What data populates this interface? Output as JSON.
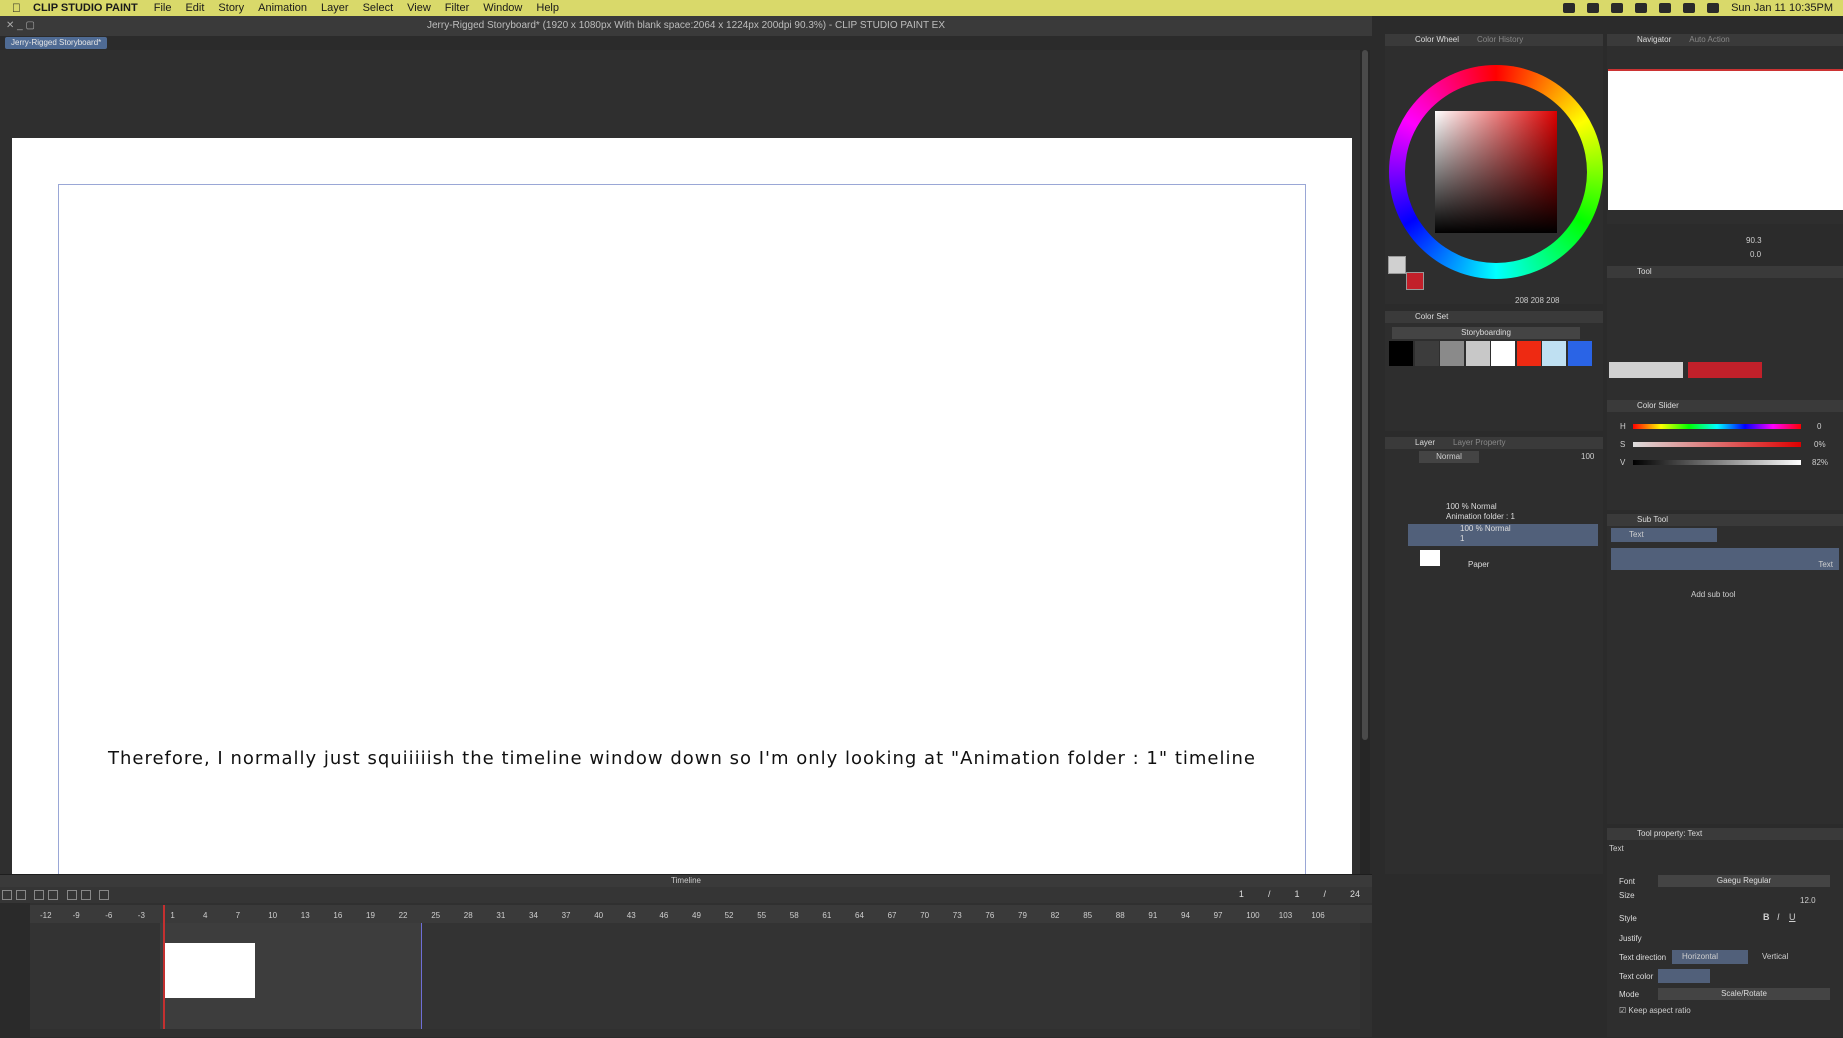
{
  "menubar": {
    "app": "CLIP STUDIO PAINT",
    "items": [
      "File",
      "Edit",
      "Story",
      "Animation",
      "Layer",
      "Select",
      "View",
      "Filter",
      "Window",
      "Help"
    ],
    "clock": "Sun Jan 11  10:35PM"
  },
  "title": "Jerry-Rigged Storyboard* (1920 x 1080px With blank space:2064 x 1224px 200dpi 90.3%)  - CLIP STUDIO PAINT EX",
  "doc_tab": "Jerry-Rigged Storyboard*",
  "canvas": {
    "caption": "Therefore, I normally just squiiiiish the timeline window down so I'm only looking at \"Animation folder : 1\" timeline"
  },
  "timeline": {
    "title": "Timeline",
    "frame_current": "1",
    "frame_sep": "/",
    "frame_total_a": "1",
    "frame_sep2": "/",
    "frame_total_b": "24",
    "ticks": [
      "-12",
      "-9",
      "-6",
      "-3",
      "1",
      "4",
      "7",
      "10",
      "13",
      "16",
      "19",
      "22",
      "25",
      "28",
      "31",
      "34",
      "37",
      "40",
      "43",
      "46",
      "49",
      "52",
      "55",
      "58",
      "61",
      "64",
      "67",
      "70",
      "73",
      "76",
      "79",
      "82",
      "85",
      "88",
      "91",
      "94",
      "97",
      "100",
      "103",
      "106"
    ]
  },
  "color_wheel": {
    "tab": "Color Wheel",
    "tab2": "Color History",
    "readout": "208  208  208",
    "main_color": "#d0d0d0",
    "sub_color": "#c2202a"
  },
  "color_set": {
    "title": "Color Set",
    "set_name": "Storyboarding",
    "chips": [
      "#000000",
      "#3c3c3c",
      "#8a8a8a",
      "#c8c8c8",
      "#ffffff",
      "#ee2a12",
      "#bfe0f2",
      "#2a64e6"
    ]
  },
  "layer": {
    "tab": "Layer",
    "tab2": "Layer Property",
    "blend": "Normal",
    "opacity": "100",
    "rows": [
      {
        "line1": "100 % Normal",
        "line2": "Animation folder : 1"
      },
      {
        "line1": "100 % Normal",
        "line2": "1"
      },
      {
        "line1": "",
        "line2": "Paper"
      }
    ]
  },
  "navigator": {
    "tab": "Navigator",
    "tab2": "Auto Action",
    "zoom": "90.3",
    "rotate": "0.0"
  },
  "tool": {
    "title": "Tool"
  },
  "color_slider": {
    "title": "Color Slider",
    "h_label": "H",
    "h_val": "0",
    "s_label": "S",
    "s_val": "0%",
    "v_label": "V",
    "v_val": "82%"
  },
  "sub_tool": {
    "title": "Sub Tool",
    "item": "Text",
    "big_label": "Text",
    "add": "Add sub tool"
  },
  "tool_property": {
    "title": "Tool property: Text",
    "subtitle": "Text",
    "font_label": "Font",
    "font": "Gaegu Regular",
    "size_label": "Size",
    "size": "12.0",
    "style_label": "Style",
    "justify_label": "Justify",
    "dir_label": "Text direction",
    "dir_h": "Horizontal",
    "dir_v": "Vertical",
    "color_label": "Text color",
    "mode_label": "Mode",
    "mode": "Scale/Rotate",
    "keep": "Keep aspect ratio"
  }
}
